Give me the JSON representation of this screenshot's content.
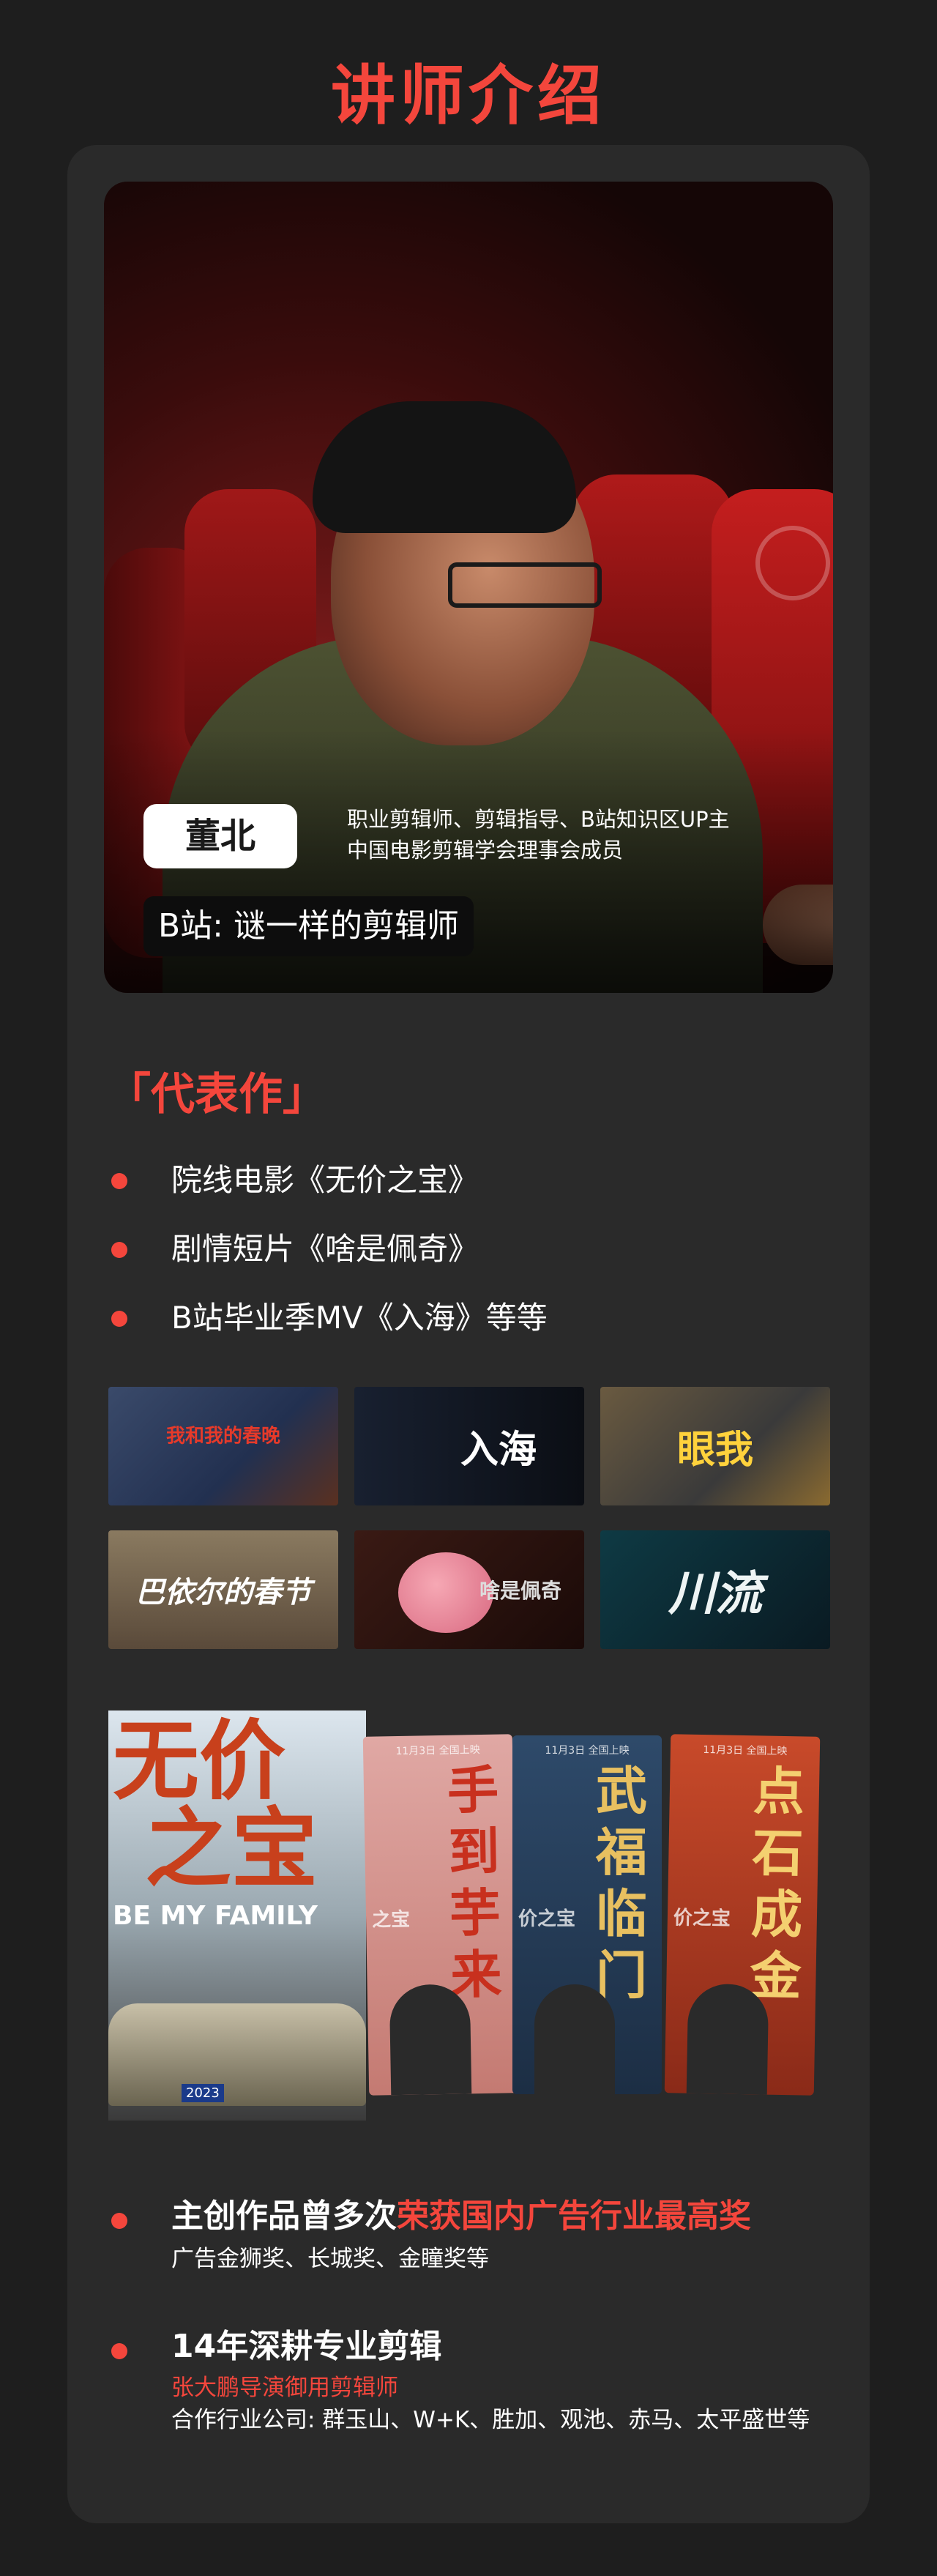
{
  "section_title": "讲师介绍",
  "instructor": {
    "name": "董北",
    "bio": [
      "职业剪辑师、剪辑指导、B站知识区UP主",
      "中国电影剪辑学会理事会成员"
    ],
    "channel": "B站: 谜一样的剪辑师"
  },
  "works": {
    "heading": "「代表作」",
    "items": [
      "院线电影《无价之宝》",
      "剧情短片《啥是佩奇》",
      "B站毕业季MV《入海》等等"
    ]
  },
  "thumbnails": [
    {
      "title": "我和我的春晚"
    },
    {
      "title": "入海"
    },
    {
      "title": "眼我"
    },
    {
      "title": "巴依尔的春节"
    },
    {
      "title": "啥是佩奇"
    },
    {
      "title": "川流"
    }
  ],
  "posters": {
    "main": {
      "title_line1": "无价",
      "title_line2": "之宝",
      "subtitle": "BE MY FAMILY",
      "plate": "2023"
    },
    "side": [
      {
        "title": "手到芋来",
        "sub": "之宝",
        "top": "11月3日 全国上映"
      },
      {
        "title": "武福临门",
        "sub": "价之宝",
        "top": "11月3日 全国上映"
      },
      {
        "title": "点石成金",
        "sub": "价之宝",
        "top": "11月3日 全国上映"
      }
    ]
  },
  "achievements": [
    {
      "prefix": "主创作品曾多次",
      "highlight": "荣获国内广告行业最高奖",
      "sub": "广告金狮奖、长城奖、金瞳奖等"
    },
    {
      "prefix": "14年深耕专业剪辑",
      "highlight": "",
      "sub_red": "张大鹏导演御用剪辑师",
      "sub": "合作行业公司: 群玉山、W+K、胜加、观池、赤马、太平盛世等"
    }
  ],
  "colors": {
    "accent": "#f4463c",
    "background": "#1e1e1e",
    "card": "#2a2a2a"
  }
}
